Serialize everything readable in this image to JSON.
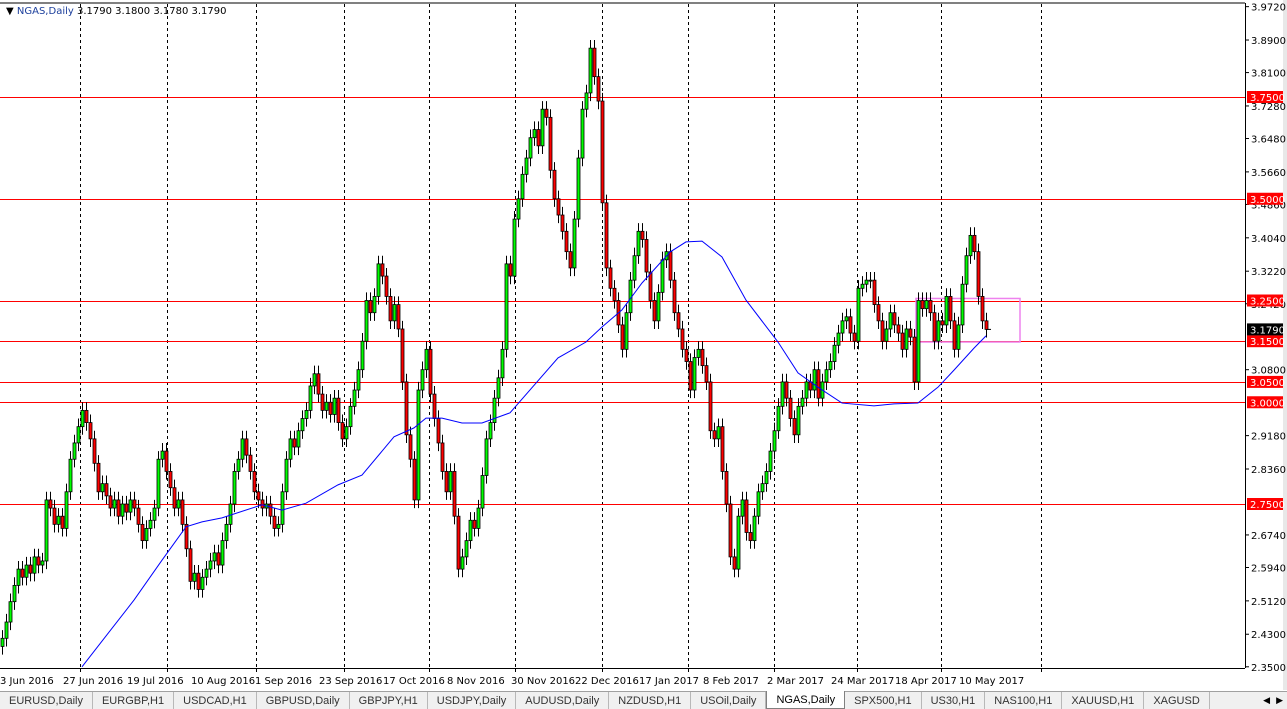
{
  "header": {
    "symbol": "NGAS,Daily",
    "ohlc": "3.1790 3.1800 3.1780 3.1790"
  },
  "colors": {
    "up": "#00ff00",
    "down": "#ff0000",
    "ma": "#0000ff",
    "level": "#ff0000",
    "box": "#ee82ee",
    "current_label": "#000000"
  },
  "tabs": [
    {
      "label": "EURUSD,Daily"
    },
    {
      "label": "EURGBP,H1"
    },
    {
      "label": "USDCAD,H1"
    },
    {
      "label": "GBPUSD,Daily"
    },
    {
      "label": "GBPJPY,H1"
    },
    {
      "label": "USDJPY,Daily"
    },
    {
      "label": "AUDUSD,Daily"
    },
    {
      "label": "NZDUSD,H1"
    },
    {
      "label": "USOil,Daily"
    },
    {
      "label": "NGAS,Daily",
      "active": true
    },
    {
      "label": "SPX500,H1"
    },
    {
      "label": "US30,H1"
    },
    {
      "label": "NAS100,H1"
    },
    {
      "label": "XAUUSD,H1"
    },
    {
      "label": "XAGUSD"
    }
  ],
  "chart_data": {
    "type": "candlestick",
    "symbol": "NGAS",
    "timeframe": "Daily",
    "ylim": [
      2.35,
      3.972
    ],
    "y_ticks": [
      "3.9720",
      "3.8900",
      "3.8100",
      "3.7280",
      "3.6480",
      "3.5660",
      "3.4860",
      "3.4040",
      "3.3220",
      "3.2420",
      "3.0800",
      "2.9180",
      "2.8360",
      "2.6740",
      "2.5940",
      "2.5120",
      "2.4300",
      "2.3500"
    ],
    "x_labels": [
      "3 Jun 2016",
      "27 Jun 2016",
      "19 Jul 2016",
      "10 Aug 2016",
      "1 Sep 2016",
      "23 Sep 2016",
      "17 Oct 2016",
      "8 Nov 2016",
      "30 Nov 2016",
      "22 Dec 2016",
      "17 Jan 2017",
      "8 Feb 2017",
      "2 Mar 2017",
      "24 Mar 2017",
      "18 Apr 2017",
      "10 May 2017"
    ],
    "first_open": 2.4,
    "closes": [
      2.42,
      2.46,
      2.51,
      2.55,
      2.59,
      2.57,
      2.6,
      2.58,
      2.62,
      2.6,
      2.61,
      2.76,
      2.74,
      2.7,
      2.72,
      2.69,
      2.78,
      2.86,
      2.9,
      2.94,
      2.98,
      2.95,
      2.91,
      2.85,
      2.78,
      2.8,
      2.77,
      2.74,
      2.76,
      2.72,
      2.75,
      2.73,
      2.76,
      2.74,
      2.7,
      2.66,
      2.69,
      2.71,
      2.74,
      2.86,
      2.88,
      2.83,
      2.79,
      2.74,
      2.76,
      2.7,
      2.64,
      2.56,
      2.58,
      2.54,
      2.57,
      2.59,
      2.61,
      2.63,
      2.6,
      2.66,
      2.7,
      2.75,
      2.83,
      2.86,
      2.91,
      2.87,
      2.83,
      2.78,
      2.76,
      2.74,
      2.75,
      2.72,
      2.69,
      2.7,
      2.78,
      2.86,
      2.91,
      2.89,
      2.93,
      2.96,
      2.98,
      3.04,
      3.07,
      3.02,
      2.98,
      3.0,
      2.97,
      3.01,
      2.95,
      2.91,
      2.94,
      2.99,
      3.03,
      3.08,
      3.15,
      3.25,
      3.22,
      3.26,
      3.34,
      3.31,
      3.26,
      3.2,
      3.24,
      3.18,
      3.05,
      2.92,
      2.86,
      2.76,
      3.03,
      3.08,
      3.13,
      3.02,
      2.96,
      2.9,
      2.83,
      2.78,
      2.83,
      2.72,
      2.59,
      2.62,
      2.66,
      2.71,
      2.69,
      2.74,
      2.82,
      2.91,
      2.95,
      3.01,
      3.06,
      3.13,
      3.34,
      3.31,
      3.45,
      3.5,
      3.56,
      3.6,
      3.65,
      3.67,
      3.63,
      3.72,
      3.7,
      3.57,
      3.5,
      3.46,
      3.42,
      3.37,
      3.33,
      3.45,
      3.6,
      3.72,
      3.76,
      3.87,
      3.8,
      3.74,
      3.49,
      3.33,
      3.28,
      3.25,
      3.19,
      3.13,
      3.22,
      3.3,
      3.36,
      3.42,
      3.4,
      3.32,
      3.25,
      3.2,
      3.27,
      3.35,
      3.37,
      3.3,
      3.22,
      3.18,
      3.13,
      3.1,
      3.03,
      3.11,
      3.13,
      3.09,
      3.05,
      2.93,
      2.91,
      2.94,
      2.83,
      2.75,
      2.62,
      2.59,
      2.72,
      2.76,
      2.68,
      2.66,
      2.72,
      2.78,
      2.8,
      2.83,
      2.88,
      2.93,
      2.99,
      3.05,
      3.01,
      2.96,
      2.92,
      2.99,
      3.01,
      3.05,
      3.03,
      3.08,
      3.01,
      3.05,
      3.08,
      3.1,
      3.14,
      3.17,
      3.2,
      3.21,
      3.17,
      3.15,
      3.28,
      3.29,
      3.3,
      3.3,
      3.24,
      3.2,
      3.15,
      3.18,
      3.22,
      3.19,
      3.17,
      3.13,
      3.18,
      3.16,
      3.05,
      3.25,
      3.23,
      3.25,
      3.22,
      3.15,
      3.2,
      3.19,
      3.26,
      3.2,
      3.13,
      3.19,
      3.29,
      3.36,
      3.41,
      3.37,
      3.26,
      3.2,
      3.179
    ],
    "moving_average": [
      [
        20,
        2.35
      ],
      [
        33,
        2.514
      ],
      [
        40,
        2.612
      ],
      [
        46,
        2.694
      ],
      [
        50,
        2.706
      ],
      [
        55,
        2.716
      ],
      [
        65,
        2.748
      ],
      [
        70,
        2.735
      ],
      [
        76,
        2.752
      ],
      [
        84,
        2.797
      ],
      [
        90,
        2.821
      ],
      [
        98,
        2.915
      ],
      [
        103,
        2.937
      ],
      [
        106,
        2.961
      ],
      [
        110,
        2.961
      ],
      [
        115,
        2.949
      ],
      [
        120,
        2.949
      ],
      [
        127,
        2.974
      ],
      [
        139,
        3.109
      ],
      [
        146,
        3.148
      ],
      [
        150,
        3.185
      ],
      [
        155,
        3.227
      ],
      [
        160,
        3.293
      ],
      [
        167,
        3.369
      ],
      [
        171,
        3.394
      ],
      [
        175,
        3.396
      ],
      [
        180,
        3.357
      ],
      [
        186,
        3.251
      ],
      [
        194,
        3.148
      ],
      [
        199,
        3.072
      ],
      [
        204,
        3.037
      ],
      [
        210,
        2.998
      ],
      [
        218,
        2.991
      ],
      [
        223,
        2.996
      ],
      [
        229,
        2.998
      ],
      [
        234,
        3.037
      ],
      [
        238,
        3.079
      ],
      [
        243,
        3.133
      ],
      [
        246,
        3.163
      ]
    ],
    "horizontal_levels": [
      {
        "value": 3.75,
        "label": "3.7500"
      },
      {
        "value": 3.5,
        "label": "3.5000"
      },
      {
        "value": 3.25,
        "label": "3.2500"
      },
      {
        "value": 3.15,
        "label": "3.1500"
      },
      {
        "value": 3.05,
        "label": "3.0500"
      },
      {
        "value": 3.0,
        "label": "3.0000"
      },
      {
        "value": 2.75,
        "label": "2.7500"
      }
    ],
    "current_price": {
      "value": 3.179,
      "label": "3.1790"
    },
    "rectangle": {
      "from_bar": 229,
      "to_bar": 255,
      "top": 3.255,
      "bottom": 3.148
    }
  }
}
